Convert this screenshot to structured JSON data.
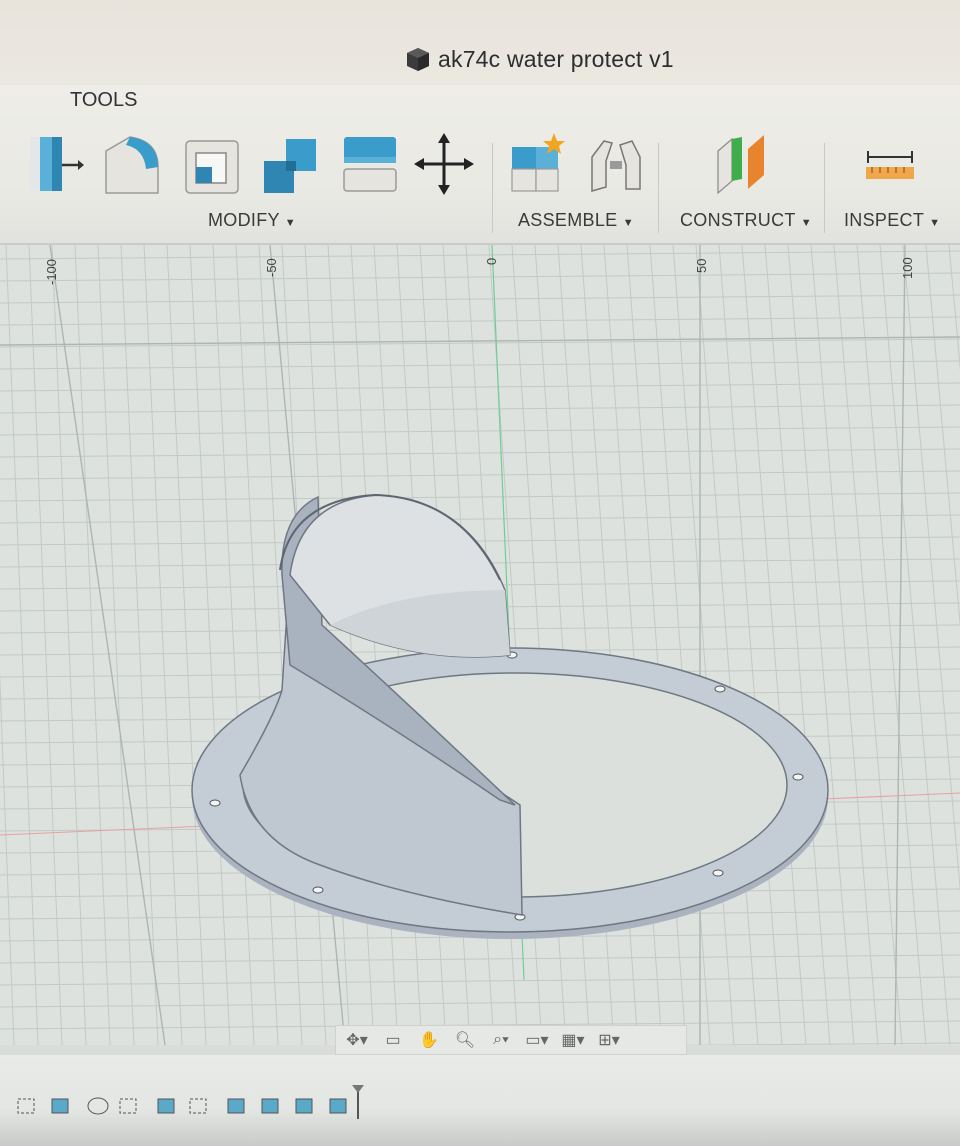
{
  "window": {
    "title": "ak74c water protect v1",
    "title_icon": "document-cube-icon"
  },
  "toolbar": {
    "active_tab": "TOOLS",
    "groups": [
      {
        "label": "MODIFY",
        "tools": [
          "press-pull-icon",
          "fillet-icon",
          "shell-icon",
          "combine-icon",
          "split-body-icon",
          "move-icon"
        ]
      },
      {
        "label": "ASSEMBLE",
        "tools": [
          "new-component-icon",
          "joint-icon"
        ]
      },
      {
        "label": "CONSTRUCT",
        "tools": [
          "offset-plane-icon"
        ]
      },
      {
        "label": "INSPECT",
        "tools": [
          "measure-icon"
        ]
      }
    ],
    "dropdown_icon": "caret-down-icon"
  },
  "viewport": {
    "ruler_labels": [
      "-100",
      "-50",
      "0",
      "50",
      "100"
    ],
    "colors": {
      "grid": "#c3c9c6",
      "grid_major": "#b3b9b6",
      "model": "#b8c0cc",
      "axis_green": "#67c98b",
      "axis_red": "#e58f94"
    }
  },
  "navigation_bar": {
    "items": [
      "orbit-icon",
      "look-at-icon",
      "pan-icon",
      "zoom-icon",
      "fit-icon",
      "display-settings-icon",
      "grid-settings-icon",
      "viewports-icon"
    ]
  },
  "timeline": {
    "items": [
      "sketch-icon",
      "extrude-icon",
      "sketch-icon",
      "sketch-icon",
      "extrude-icon",
      "extrude-icon",
      "sketch-icon",
      "extrude-icon",
      "extrude-icon",
      "extrude-icon",
      "extrude-icon",
      "extrude-icon"
    ],
    "marker": "timeline-marker-icon"
  }
}
